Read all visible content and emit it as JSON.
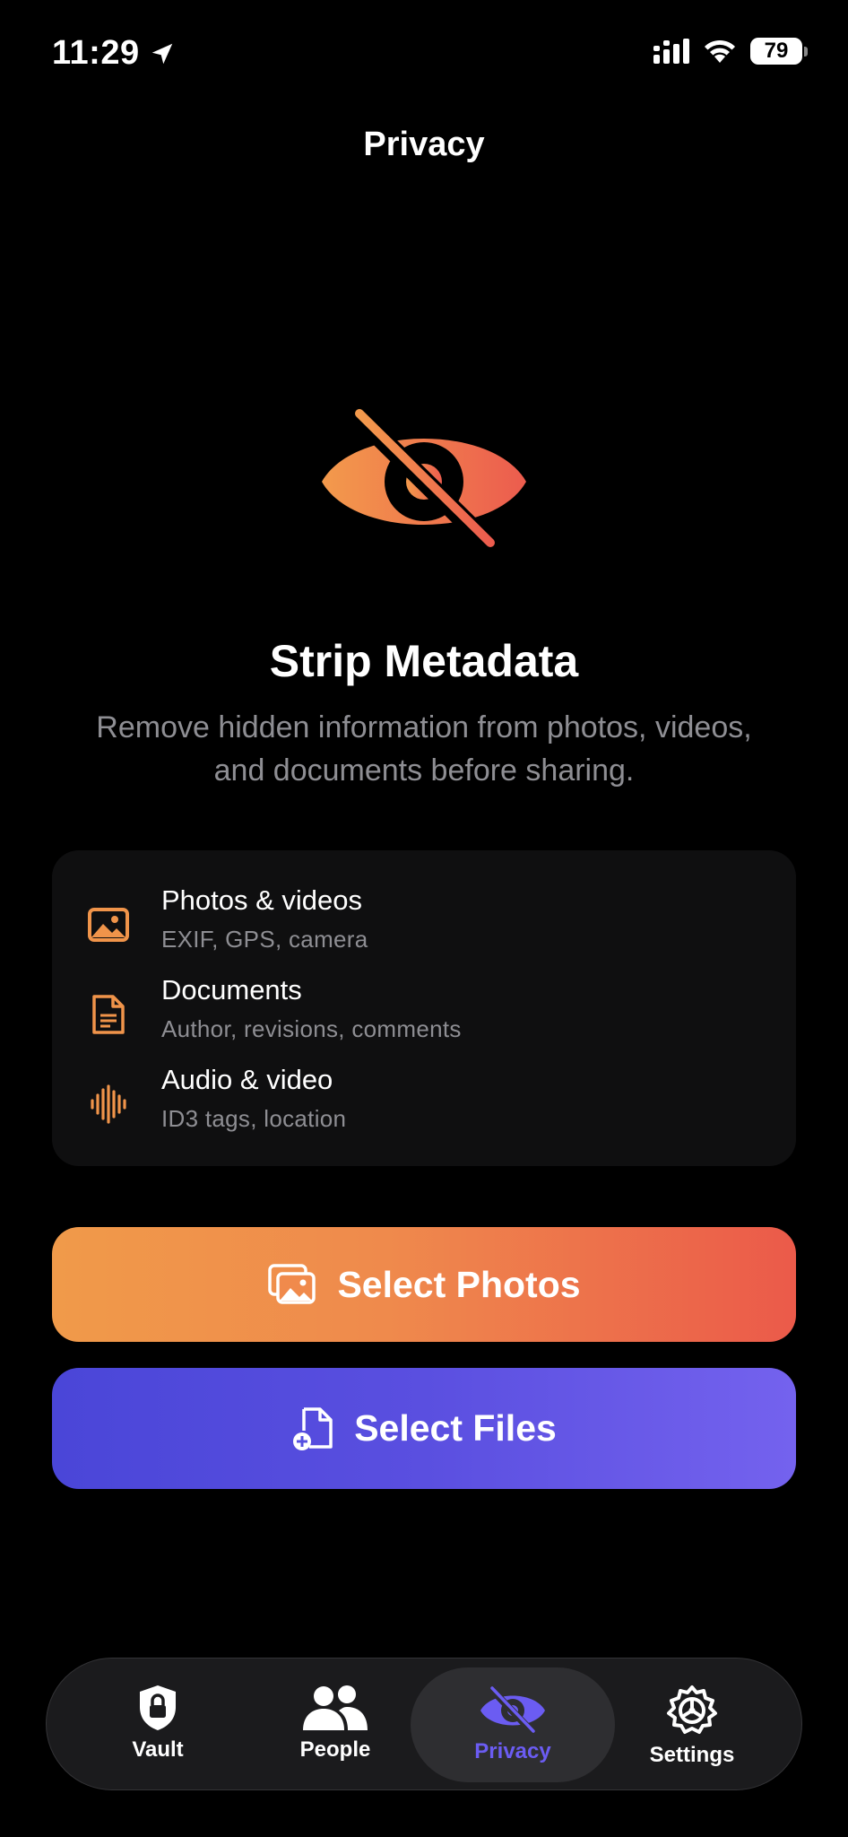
{
  "status": {
    "time": "11:29",
    "battery": "79"
  },
  "nav": {
    "title": "Privacy"
  },
  "hero": {
    "title": "Strip Metadata",
    "subtitle_line1": "Remove hidden information from photos, videos,",
    "subtitle_line2": "and documents before sharing."
  },
  "features": [
    {
      "icon": "photo-icon",
      "title": "Photos & videos",
      "desc": "EXIF, GPS, camera"
    },
    {
      "icon": "document-icon",
      "title": "Documents",
      "desc": "Author, revisions, comments"
    },
    {
      "icon": "waveform-icon",
      "title": "Audio & video",
      "desc": "ID3 tags, location"
    }
  ],
  "buttons": {
    "select_photos": "Select Photos",
    "select_files": "Select Files"
  },
  "tabs": [
    {
      "label": "Vault",
      "icon": "lock-shield-icon"
    },
    {
      "label": "People",
      "icon": "people-icon"
    },
    {
      "label": "Privacy",
      "icon": "eye-slash-icon",
      "active": true
    },
    {
      "label": "Settings",
      "icon": "gear-icon"
    }
  ],
  "colors": {
    "accent_orange": "#F0944A",
    "accent_red": "#EB5A4A",
    "accent_purple": "#6B5CF2",
    "accent_indigo": "#4A46D8"
  }
}
